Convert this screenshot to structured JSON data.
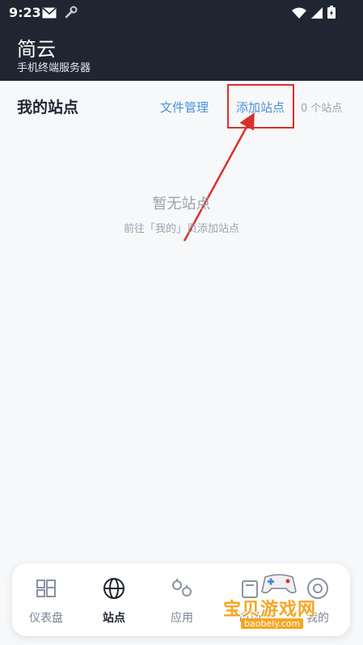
{
  "status_bar": {
    "time": "9:23"
  },
  "header": {
    "title": "简云",
    "subtitle": "手机终端服务器"
  },
  "main": {
    "section_title": "我的站点",
    "file_manage_label": "文件管理",
    "add_site_label": "添加站点",
    "site_count": "0 个站点",
    "empty_title": "暂无站点",
    "empty_hint": "前往「我的」页添加站点"
  },
  "tabs": [
    {
      "label": "仪表盘",
      "icon": "dashboard-icon",
      "active": false
    },
    {
      "label": "站点",
      "icon": "globe-icon",
      "active": true
    },
    {
      "label": "应用",
      "icon": "apps-icon",
      "active": false
    },
    {
      "label": "市场",
      "icon": "market-icon",
      "active": false
    },
    {
      "label": "我的",
      "icon": "user-icon",
      "active": false
    }
  ],
  "watermark": {
    "text": "宝贝游戏网",
    "url": "baobeiy.com"
  },
  "colors": {
    "header_bg": "#1f2632",
    "accent": "#4a90d9",
    "annotation": "#d9302b",
    "muted": "#9aa3af"
  }
}
